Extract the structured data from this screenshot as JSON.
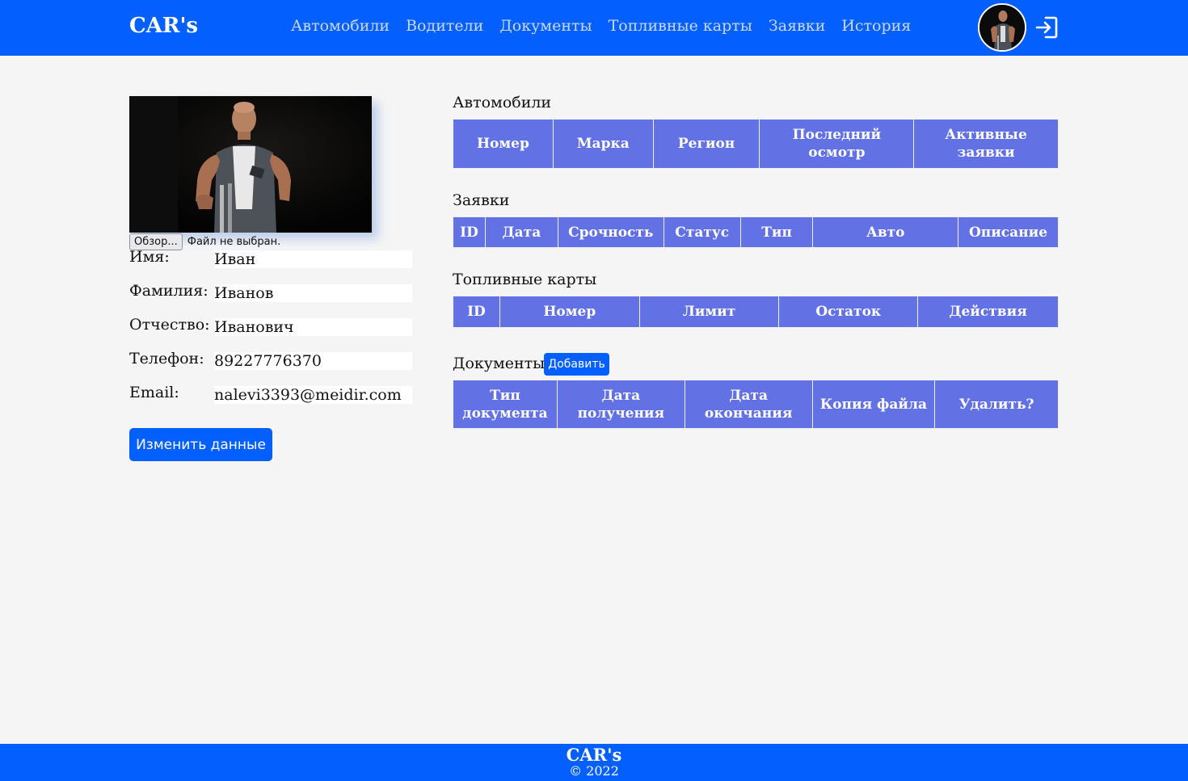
{
  "header": {
    "brand": "CAR's",
    "nav": [
      "Автомобили",
      "Водители",
      "Документы",
      "Топливные карты",
      "Заявки",
      "История"
    ]
  },
  "profile": {
    "file_button": "Обзор...",
    "file_status": "Файл не выбран.",
    "fields": [
      {
        "label": "Имя:",
        "value": "Иван"
      },
      {
        "label": "Фамилия:",
        "value": "Иванов"
      },
      {
        "label": "Отчество:",
        "value": "Иванович"
      },
      {
        "label": "Телефон:",
        "value": "89227776370"
      },
      {
        "label": "Email:",
        "value": "nalevi3393@meidir.com"
      }
    ],
    "edit_button": "Изменить данные"
  },
  "sections": {
    "cars": {
      "title": "Автомобили",
      "columns": [
        "Номер",
        "Марка",
        "Регион",
        "Последний осмотр",
        "Активные заявки"
      ]
    },
    "requests": {
      "title": "Заявки",
      "columns": [
        "ID",
        "Дата",
        "Срочность",
        "Статус",
        "Тип",
        "Авто",
        "Описание"
      ]
    },
    "fuel_cards": {
      "title": "Топливные карты",
      "columns": [
        "ID",
        "Номер",
        "Лимит",
        "Остаток",
        "Действия"
      ]
    },
    "documents": {
      "title": "Документы",
      "add_button": "Добавить",
      "columns": [
        "Тип документа",
        "Дата получения",
        "Дата окончания",
        "Копия файла",
        "Удалить?"
      ]
    }
  },
  "footer": {
    "brand": "CAR's",
    "copyright": "© 2022"
  },
  "colors": {
    "primary": "#0360ff",
    "table_header": "#6272e4",
    "background": "#f5f5f5"
  },
  "icons": {
    "logout": "logout-icon"
  }
}
